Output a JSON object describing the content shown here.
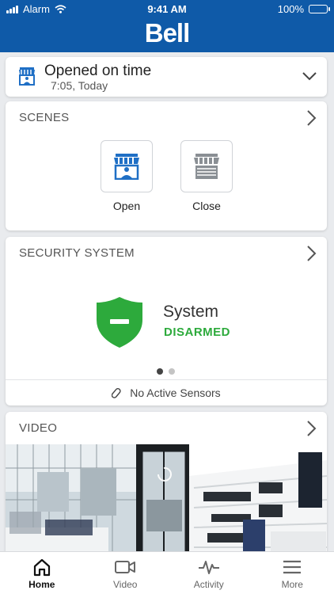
{
  "status_bar": {
    "carrier": "Alarm",
    "time": "9:41 AM",
    "battery": "100%"
  },
  "brand": {
    "logo_text": "Bell",
    "color": "#0f5aa8"
  },
  "status_card": {
    "title": "Opened on time",
    "subtitle": "7:05, Today",
    "icon": "storefront-icon"
  },
  "scenes": {
    "header": "SCENES",
    "items": [
      {
        "label": "Open",
        "icon": "store-open-icon"
      },
      {
        "label": "Close",
        "icon": "store-closed-icon"
      }
    ]
  },
  "security": {
    "header": "SECURITY SYSTEM",
    "system_name": "System",
    "state": "DISARMED",
    "state_color": "#2daa3c",
    "pager": {
      "count": 2,
      "active": 1
    },
    "sensors_text": "No Active Sensors"
  },
  "video": {
    "header": "VIDEO"
  },
  "tabs": [
    {
      "label": "Home",
      "icon": "home-icon",
      "active": true
    },
    {
      "label": "Video",
      "icon": "video-camera-icon",
      "active": false
    },
    {
      "label": "Activity",
      "icon": "activity-pulse-icon",
      "active": false
    },
    {
      "label": "More",
      "icon": "menu-icon",
      "active": false
    }
  ]
}
